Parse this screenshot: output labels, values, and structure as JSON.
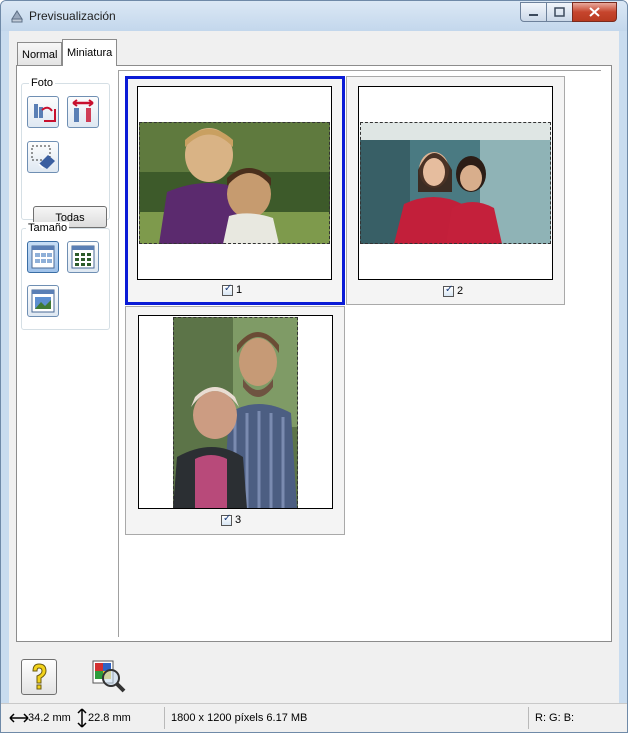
{
  "window": {
    "title": "Previsualización"
  },
  "tabs": [
    {
      "label": "Normal"
    },
    {
      "label": "Miniatura"
    }
  ],
  "left_panel": {
    "foto_group": {
      "label": "Foto",
      "all_button": "Todas"
    },
    "size_group": {
      "label": "Tamaño"
    }
  },
  "thumbnails": [
    {
      "number": "1",
      "checked": true,
      "selected": true
    },
    {
      "number": "2",
      "checked": true,
      "selected": false
    },
    {
      "number": "3",
      "checked": true,
      "selected": false
    }
  ],
  "status_bar": {
    "width": "34.2 mm",
    "height": "22.8 mm",
    "info": "1800 x 1200 píxels 6.17 MB",
    "rgb": "R: G: B:"
  },
  "colors": {
    "selection": "#0a1bd6",
    "accent": "#c8102e"
  }
}
